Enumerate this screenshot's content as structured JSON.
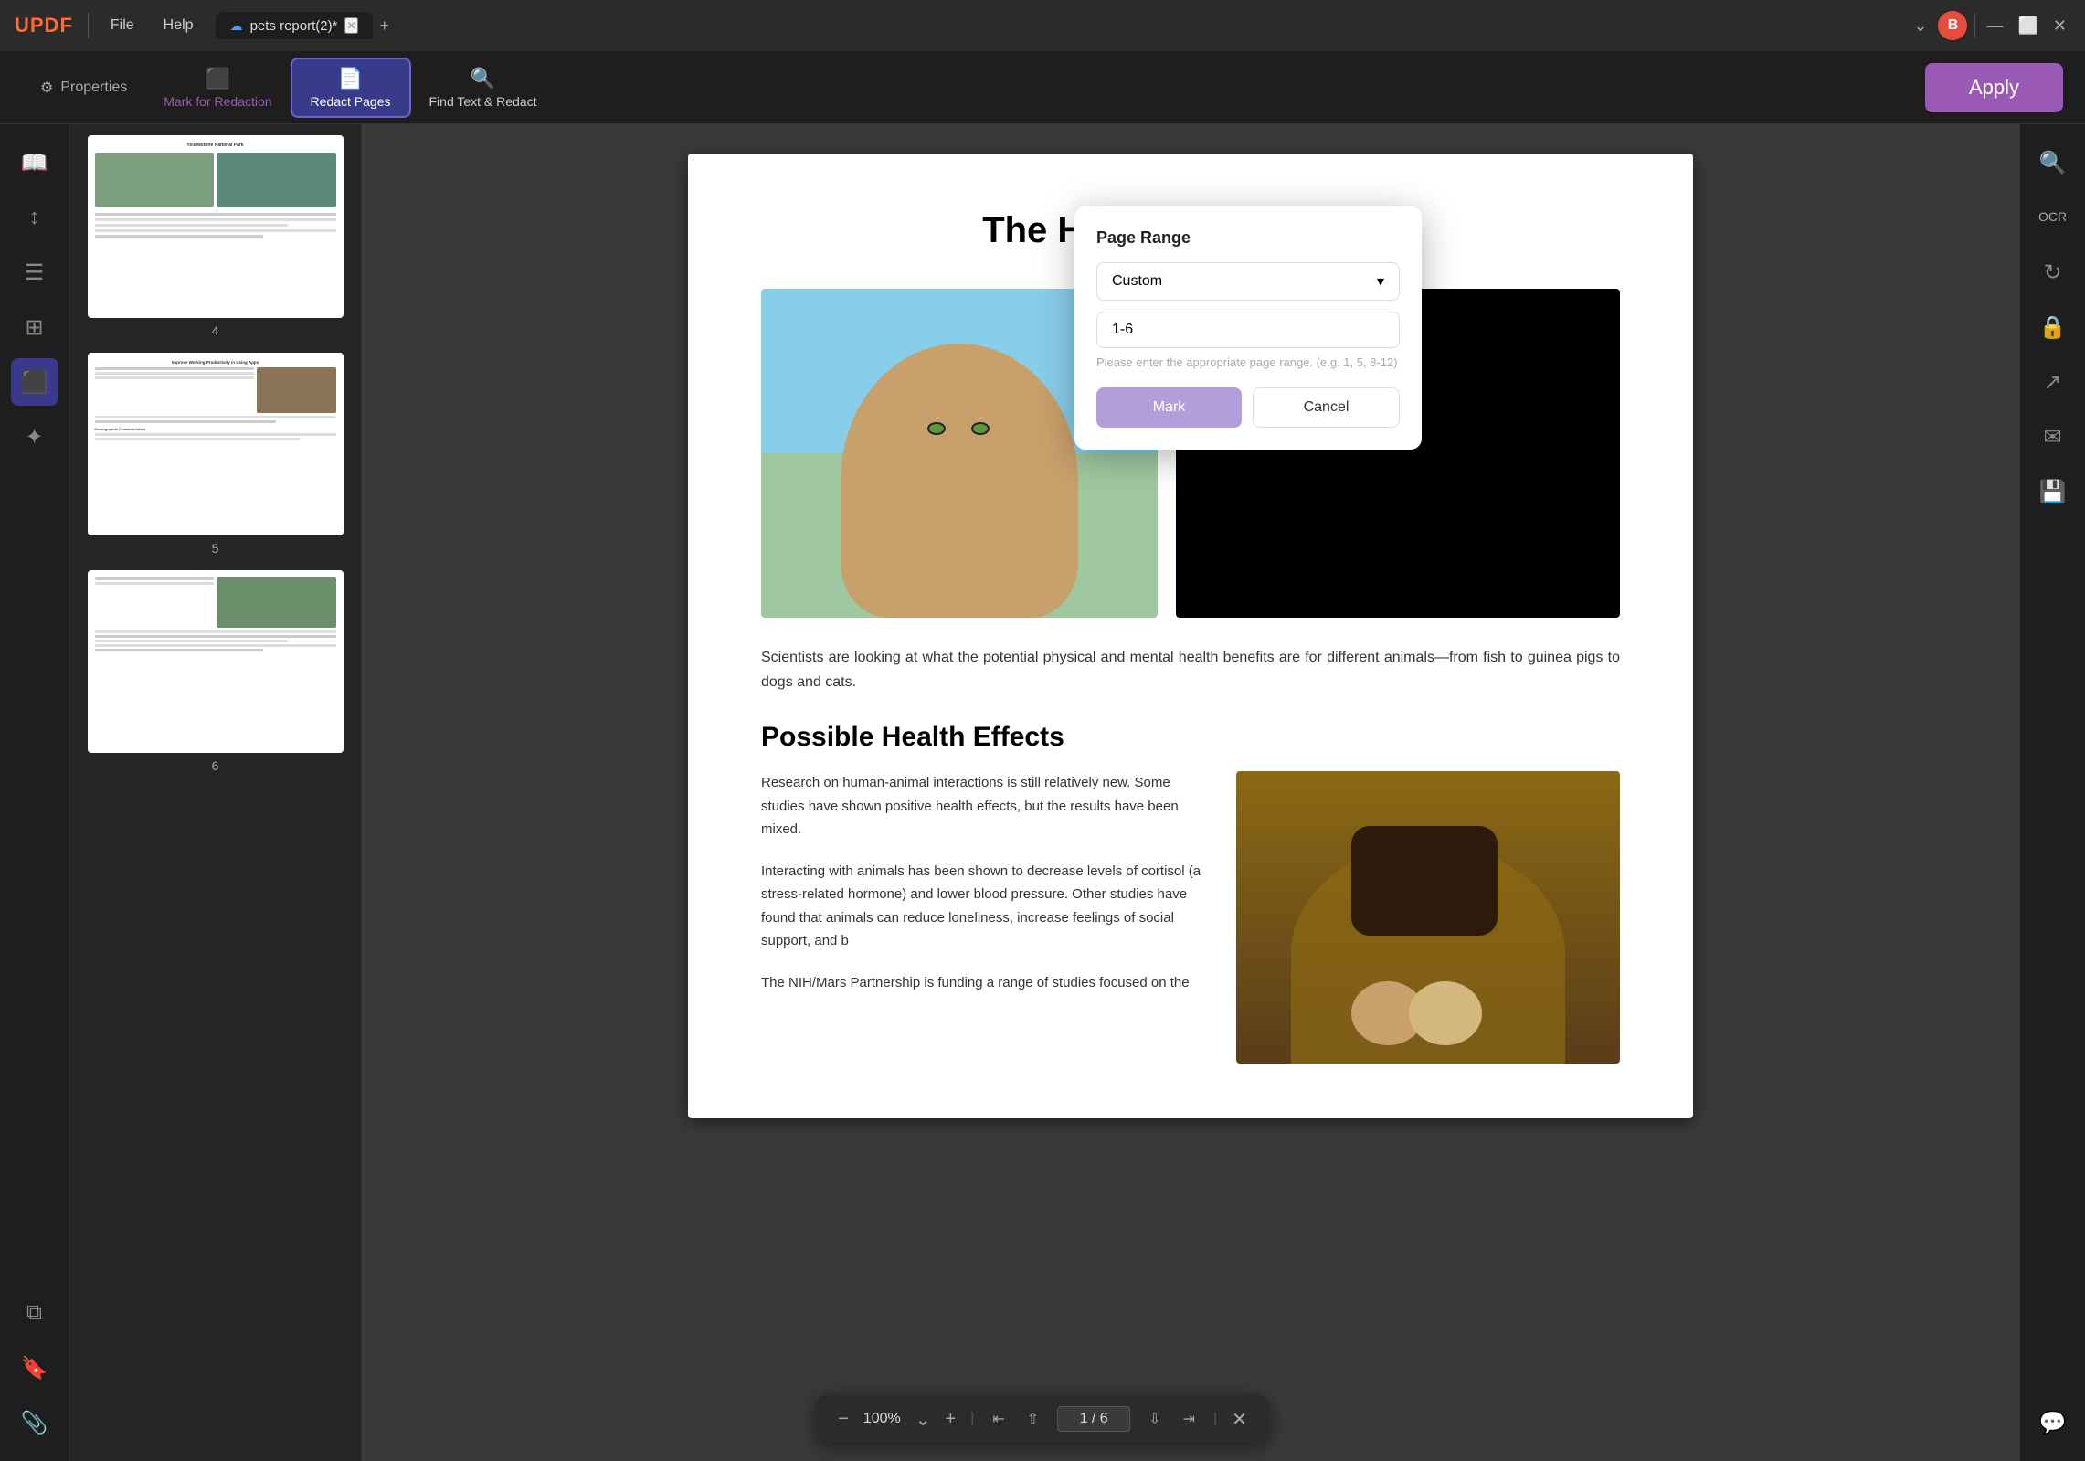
{
  "app": {
    "logo": "UPDF",
    "file_menu": "File",
    "help_menu": "Help"
  },
  "tab": {
    "title": "pets report(2)*",
    "cloud_icon": "☁",
    "close_icon": "✕",
    "add_icon": "+"
  },
  "titlebar": {
    "chevron_down": "⌄",
    "minimize": "—",
    "maximize": "⬜",
    "close": "✕",
    "search": "🔍",
    "avatar_initial": "B"
  },
  "toolbar": {
    "properties_label": "Properties",
    "mark_for_redaction_label": "Mark for Redaction",
    "redact_pages_label": "Redact Pages",
    "find_text_redact_label": "Find Text & Redact",
    "apply_label": "Apply"
  },
  "left_sidebar": {
    "icons": [
      {
        "name": "reader-icon",
        "symbol": "📖"
      },
      {
        "name": "scroll-icon",
        "symbol": "↕"
      },
      {
        "name": "list-icon",
        "symbol": "☰"
      },
      {
        "name": "pages-icon",
        "symbol": "⊞"
      },
      {
        "name": "redact-icon",
        "symbol": "⬛"
      },
      {
        "name": "stamp-icon",
        "symbol": "✦"
      },
      {
        "name": "layers-icon",
        "symbol": "⧉"
      },
      {
        "name": "bookmark-icon",
        "symbol": "🔖"
      },
      {
        "name": "attach-icon",
        "symbol": "📎"
      }
    ],
    "bottom_icons": [
      {
        "name": "layers-bottom-icon",
        "symbol": "⧉"
      },
      {
        "name": "bookmark-bottom-icon",
        "symbol": "🔖"
      },
      {
        "name": "paperclip-icon",
        "symbol": "📎"
      }
    ]
  },
  "thumbnails": [
    {
      "num": "4",
      "active": false
    },
    {
      "num": "5",
      "active": false
    },
    {
      "num": "6",
      "active": false
    }
  ],
  "document": {
    "title": "The Health and Benefits",
    "intro_text": "Scientists are looking at what the potential physical and mental health benefits are for different animals—from fish to guinea pigs to dogs and cats.",
    "section_title": "Possible Health Effects",
    "health_para1": "Research on human-animal interactions is still relatively new. Some studies have shown positive health effects, but the results have been mixed.",
    "health_para2": "Interacting with animals has been shown to decrease levels of cortisol (a stress-related hormone) and lower blood pressure. Other studies have found that animals can reduce loneliness, increase feelings of social support, and b",
    "health_para3": "The NIH/Mars Partnership is funding a range of studies focused on the"
  },
  "thumbnails_content": [
    {
      "label": "Yellowstone National Park",
      "lines": 8,
      "has_image": true,
      "num": "4"
    },
    {
      "label": "Improve Working Productivity in Using Apps",
      "lines": 6,
      "has_image": true,
      "num": "5"
    },
    {
      "label": "",
      "lines": 6,
      "has_image": true,
      "num": "6"
    }
  ],
  "popup": {
    "title": "Page Range",
    "select_label": "Custom",
    "select_chevron": "▾",
    "input_value": "1-6",
    "input_placeholder": "Please enter the appropriate page range. (e.g. 1, 5, 8-12)",
    "mark_button": "Mark",
    "cancel_button": "Cancel"
  },
  "bottom_bar": {
    "zoom_out": "−",
    "zoom_level": "100%",
    "zoom_chevron": "⌄",
    "zoom_in": "+",
    "sep1": "|",
    "first_page": "⇤",
    "prev_page": "⇧",
    "page_display": "1 / 6",
    "next_page": "⇩",
    "last_page": "⇥",
    "sep2": "|",
    "close": "✕"
  },
  "right_sidebar": {
    "icons": [
      {
        "name": "search-right-icon",
        "symbol": "🔍"
      },
      {
        "name": "ocr-icon",
        "symbol": "📝"
      },
      {
        "name": "convert-icon",
        "symbol": "↻"
      },
      {
        "name": "lock-icon",
        "symbol": "🔒"
      },
      {
        "name": "share-icon",
        "symbol": "↗"
      },
      {
        "name": "mail-icon",
        "symbol": "✉"
      },
      {
        "name": "save-icon",
        "symbol": "💾"
      },
      {
        "name": "chat-icon",
        "symbol": "💬"
      }
    ]
  }
}
